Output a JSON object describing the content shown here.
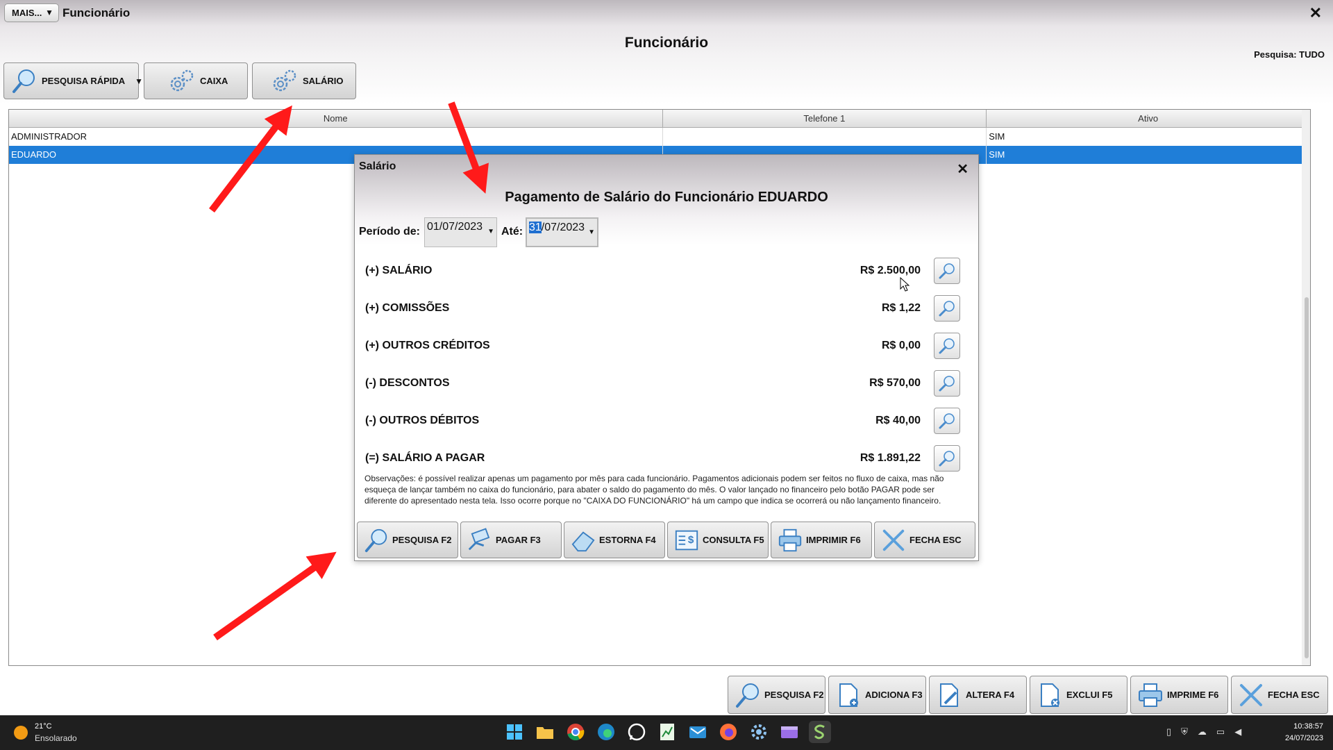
{
  "window": {
    "mais_label": "MAIS...",
    "mais_arrow": "▼",
    "title": "Funcionário",
    "close": "✕"
  },
  "page": {
    "title": "Funcionário",
    "search_status": "Pesquisa: TUDO"
  },
  "toolbar": {
    "quick_search": "PESQUISA RÁPIDA",
    "quick_search_arrow": "▼",
    "caixa": "CAIXA",
    "salario": "SALÁRIO"
  },
  "grid": {
    "columns": [
      "Nome",
      "Telefone 1",
      "Ativo"
    ],
    "rows": [
      {
        "nome": "ADMINISTRADOR",
        "telefone": "",
        "ativo": "SIM"
      },
      {
        "nome": "EDUARDO",
        "telefone": "",
        "ativo": "SIM",
        "selected": true
      }
    ]
  },
  "dialog": {
    "title": "Salário",
    "close": "✕",
    "heading": "Pagamento de Salário do Funcionário EDUARDO",
    "periodo_label": "Período de:",
    "date_from": "01/07/2023",
    "ate_label": "Até:",
    "date_to_selected": "31",
    "date_to_rest": "/07/2023",
    "items": [
      {
        "label": "(+) SALÁRIO",
        "value": "R$ 2.500,00"
      },
      {
        "label": "(+) COMISSÕES",
        "value": "R$ 1,22"
      },
      {
        "label": "(+) OUTROS CRÉDITOS",
        "value": "R$ 0,00"
      },
      {
        "label": "(-) DESCONTOS",
        "value": "R$ 570,00"
      },
      {
        "label": "(-) OUTROS DÉBITOS",
        "value": "R$ 40,00"
      },
      {
        "label": "(=) SALÁRIO A PAGAR",
        "value": "R$ 1.891,22"
      }
    ],
    "observacoes": "Observações: é possível realizar apenas um pagamento por mês para cada funcionário. Pagamentos adicionais podem ser feitos no fluxo de caixa, mas não esqueça de lançar também no caixa do funcionário, para abater o saldo do pagamento do mês. O valor lançado no financeiro pelo botão PAGAR pode ser diferente do apresentado nesta tela. Isso ocorre porque no \"CAIXA DO FUNCIONÁRIO\" há um campo que indica se ocorrerá ou não lançamento financeiro.",
    "buttons": {
      "pesquisa": "PESQUISA F2",
      "pagar": "PAGAR F3",
      "estorna": "ESTORNA F4",
      "consulta": "CONSULTA F5",
      "imprimir": "IMPRIMIR F6",
      "fecha": "FECHA ESC"
    }
  },
  "bottom_buttons": {
    "pesquisa": "PESQUISA F2",
    "adiciona": "ADICIONA F3",
    "altera": "ALTERA F4",
    "exclui": "EXCLUI F5",
    "imprime": "IMPRIME F6",
    "fecha": "FECHA ESC"
  },
  "taskbar": {
    "weather_temp": "21°C",
    "weather_desc": "Ensolarado",
    "time": "10:38:57",
    "date": "24/07/2023",
    "apps": [
      "windows-start-icon",
      "file-explorer-icon",
      "chrome-icon",
      "edge-icon",
      "whatsapp-icon",
      "spreadsheet-icon",
      "mail-icon",
      "firefox-icon",
      "settings-icon",
      "video-editor-icon",
      "app-s-icon"
    ]
  },
  "colors": {
    "selection": "#1f7ed8",
    "arrow": "#ff1a1a",
    "title_gradient": "#bdb8bd"
  }
}
